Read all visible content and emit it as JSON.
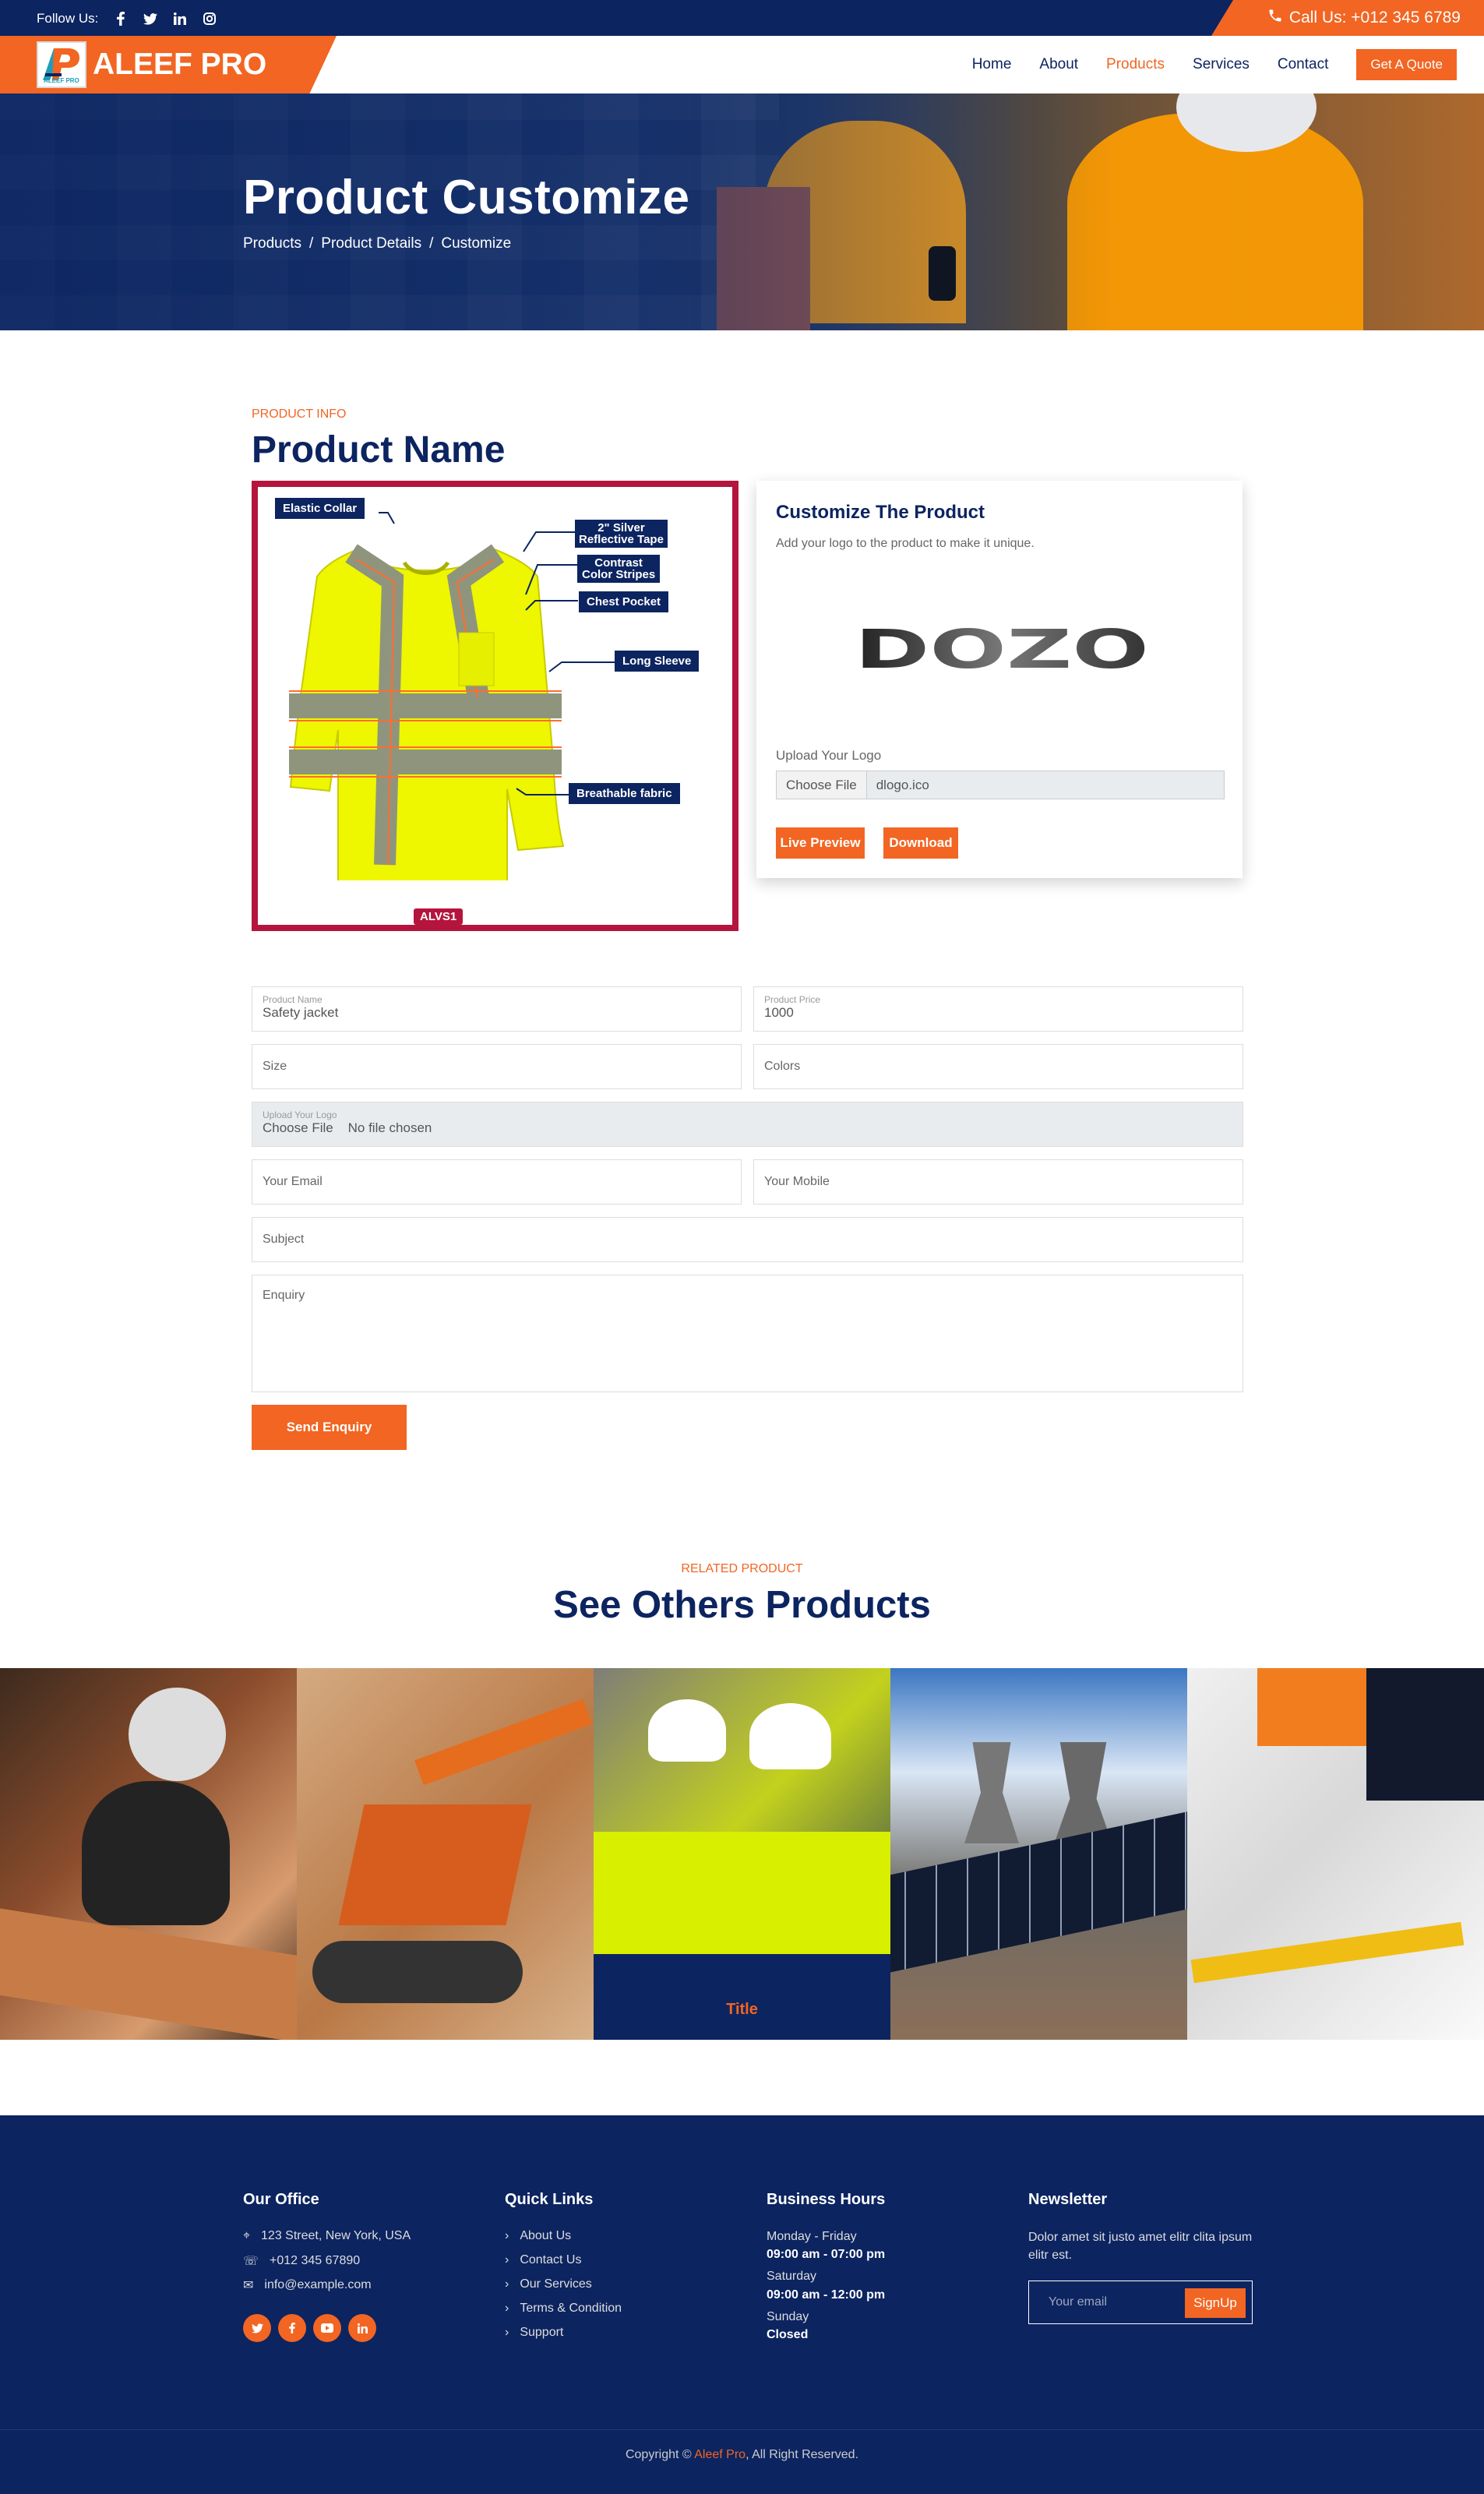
{
  "topbar": {
    "follow_label": "Follow Us:",
    "phone": "Call Us: +012 345 6789",
    "social": [
      "facebook-icon",
      "twitter-icon",
      "linkedin-icon",
      "instagram-icon"
    ]
  },
  "brand": {
    "logo_initials": "AP",
    "logo_small": "ALEEF PRO",
    "name": "ALEEF PRO"
  },
  "nav": {
    "items": [
      "Home",
      "About",
      "Products",
      "Services",
      "Contact"
    ],
    "active": "Products",
    "quote": "Get A Quote"
  },
  "hero": {
    "title": "Product Customize",
    "breadcrumb": [
      "Products",
      "Product Details",
      "Customize"
    ]
  },
  "product": {
    "kicker": "PRODUCT INFO",
    "name": "Product Name",
    "code": "ALVS1",
    "callouts": [
      "Elastic Collar",
      "2\" Silver\nReflective Tape",
      "Contrast\nColor Stripes",
      "Chest Pocket",
      "Long Sleeve",
      "Breathable fabric"
    ]
  },
  "customizer": {
    "title": "Customize The Product",
    "subtitle": "Add your logo to the product to make it unique.",
    "logo_text": "DOZO",
    "upload_label": "Upload Your Logo",
    "choose_file": "Choose File",
    "file_name": "dlogo.ico",
    "preview": "Live Preview",
    "download": "Download"
  },
  "form": {
    "product_name_label": "Product Name",
    "product_name": "Safety jacket",
    "product_price_label": "Product Price",
    "product_price": "1000",
    "size": "Size",
    "colors": "Colors",
    "logo_label": "Upload Your Logo",
    "choose_file": "Choose File",
    "no_file": "No file chosen",
    "email": "Your Email",
    "mobile": "Your Mobile",
    "subject": "Subject",
    "enquiry": "Enquiry",
    "send": "Send Enquiry"
  },
  "related": {
    "kicker": "RELATED PRODUCT",
    "title": "See Others Products",
    "highlight_title": "Title"
  },
  "footer": {
    "office_title": "Our Office",
    "address": "123 Street, New York, USA",
    "phone": "+012 345 67890",
    "email": "info@example.com",
    "links_title": "Quick Links",
    "links": [
      "About Us",
      "Contact Us",
      "Our Services",
      "Terms & Condition",
      "Support"
    ],
    "hours_title": "Business Hours",
    "weekday": "Monday - Friday",
    "weekday_hours": "09:00 am - 07:00 pm",
    "saturday": "Saturday",
    "saturday_hours": "09:00 am - 12:00 pm",
    "sunday": "Sunday",
    "sunday_status": "Closed",
    "newsletter_title": "Newsletter",
    "newsletter_text": "Dolor amet sit justo amet elitr clita ipsum elitr est.",
    "email_placeholder": "Your email",
    "signup": "SignUp",
    "copyright_prefix": "Copyright © ",
    "copyright_brand": "Aleef Pro",
    "copyright_suffix": ", All Right Reserved."
  },
  "colors": {
    "navy": "#0c2460",
    "orange": "#f26522",
    "crimson": "#b5143d"
  }
}
